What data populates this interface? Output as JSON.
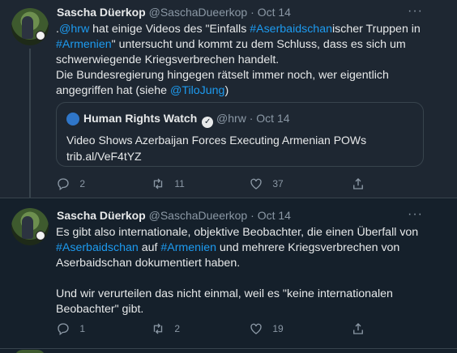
{
  "tweets": [
    {
      "author_name": "Sascha Düerkop",
      "author_handle": "@SaschaDueerkop",
      "separator": "·",
      "date": "Oct 14",
      "more": "···",
      "text": {
        "l1_a": ".",
        "l1_mention": "@hrw",
        "l1_b": " hat einige Videos des \"Einfalls ",
        "l1_tag": "#Aserbaidschan",
        "l1_c": "ischer Truppen in",
        "l2_tag": "#Armenien",
        "l2_b": "\" untersucht und kommt zu dem Schluss, dass es sich um",
        "l3": "schwerwiegende Kriegsverbrechen handelt.",
        "l4": "Die Bundesregierung hingegen rätselt immer noch, wer eigentlich",
        "l5_a": "angegriffen hat (siehe ",
        "l5_mention": "@TiloJung",
        "l5_b": ")"
      },
      "quote": {
        "name": "Human Rights Watch",
        "verified": "✓",
        "handle": "@hrw",
        "separator": "·",
        "date": "Oct 14",
        "line1": "Video Shows Azerbaijan Forces Executing Armenian POWs",
        "line2": "trib.al/VeF4tYZ"
      },
      "actions": {
        "replies": "2",
        "retweets": "11",
        "likes": "37"
      }
    },
    {
      "author_name": "Sascha Düerkop",
      "author_handle": "@SaschaDueerkop",
      "separator": "·",
      "date": "Oct 14",
      "more": "···",
      "text": {
        "l1": "Es gibt also internationale, objektive Beobachter, die einen Überfall von",
        "l2_tag": "#Aserbaidschan",
        "l2_b": " auf ",
        "l2_tag2": "#Armenien",
        "l2_c": " und mehrere Kriegsverbrechen von",
        "l3": "Aserbaidschan dokumentiert haben.",
        "l5": "Und wir verurteilen das nicht einmal, weil es \"keine internationalen",
        "l6": "Beobachter\" gibt."
      },
      "actions": {
        "replies": "1",
        "retweets": "2",
        "likes": "19"
      }
    }
  ],
  "colors": {
    "background": "#15202b",
    "highlight_background": "#1e2732",
    "link": "#1d9bf0",
    "muted": "#8b98a5",
    "border": "#38444d"
  }
}
